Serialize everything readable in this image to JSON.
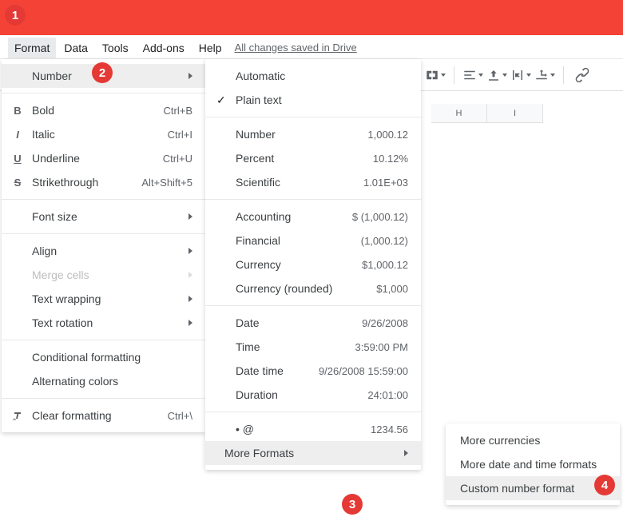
{
  "menubar": {
    "format": "Format",
    "data": "Data",
    "tools": "Tools",
    "addons": "Add-ons",
    "help": "Help",
    "drive_status": "All changes saved in Drive"
  },
  "columns": {
    "h": "H",
    "i": "I"
  },
  "format_menu": {
    "number": {
      "label": "Number"
    },
    "bold": {
      "label": "Bold",
      "shortcut": "Ctrl+B"
    },
    "italic": {
      "label": "Italic",
      "shortcut": "Ctrl+I"
    },
    "underline": {
      "label": "Underline",
      "shortcut": "Ctrl+U"
    },
    "strike": {
      "label": "Strikethrough",
      "shortcut": "Alt+Shift+5"
    },
    "font_size": {
      "label": "Font size"
    },
    "align": {
      "label": "Align"
    },
    "merge": {
      "label": "Merge cells"
    },
    "wrap": {
      "label": "Text wrapping"
    },
    "rotation": {
      "label": "Text rotation"
    },
    "conditional": {
      "label": "Conditional formatting"
    },
    "alternating": {
      "label": "Alternating colors"
    },
    "clear": {
      "label": "Clear formatting",
      "shortcut": "Ctrl+\\"
    }
  },
  "number_menu": {
    "automatic": {
      "label": "Automatic"
    },
    "plain": {
      "label": "Plain text"
    },
    "number": {
      "label": "Number",
      "example": "1,000.12"
    },
    "percent": {
      "label": "Percent",
      "example": "10.12%"
    },
    "scientific": {
      "label": "Scientific",
      "example": "1.01E+03"
    },
    "accounting": {
      "label": "Accounting",
      "example": "$ (1,000.12)"
    },
    "financial": {
      "label": "Financial",
      "example": "(1,000.12)"
    },
    "currency": {
      "label": "Currency",
      "example": "$1,000.12"
    },
    "currency_r": {
      "label": "Currency (rounded)",
      "example": "$1,000"
    },
    "date": {
      "label": "Date",
      "example": "9/26/2008"
    },
    "time": {
      "label": "Time",
      "example": "3:59:00 PM"
    },
    "datetime": {
      "label": "Date time",
      "example": "9/26/2008 15:59:00"
    },
    "duration": {
      "label": "Duration",
      "example": "24:01:00"
    },
    "custom1": {
      "label": "• @",
      "example": "1234.56"
    },
    "more": {
      "label": "More Formats"
    }
  },
  "more_formats_menu": {
    "currencies": "More currencies",
    "datetime": "More date and time formats",
    "custom": "Custom number format"
  },
  "callouts": {
    "c1": "1",
    "c2": "2",
    "c3": "3",
    "c4": "4"
  }
}
